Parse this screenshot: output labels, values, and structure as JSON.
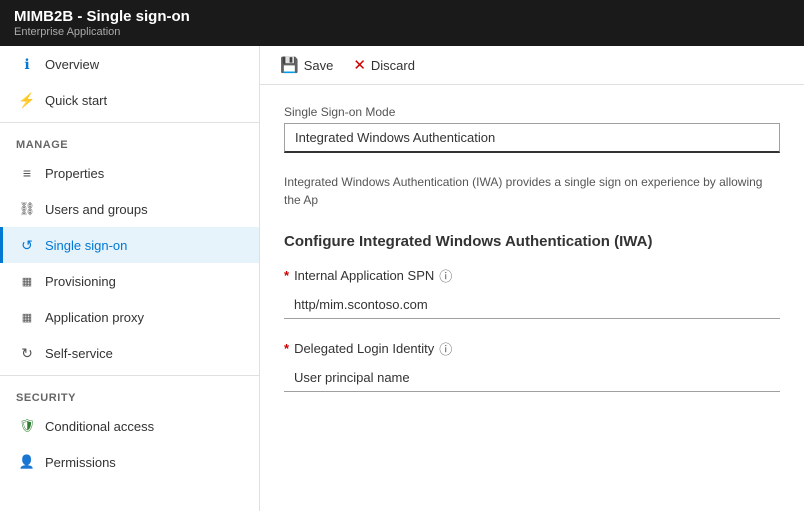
{
  "topbar": {
    "title": "MIMB2B - Single sign-on",
    "subtitle": "Enterprise Application"
  },
  "toolbar": {
    "save_label": "Save",
    "discard_label": "Discard"
  },
  "sidebar": {
    "items_top": [
      {
        "id": "overview",
        "label": "Overview",
        "icon": "ℹ",
        "icon_class": "icon-overview",
        "active": false
      },
      {
        "id": "quickstart",
        "label": "Quick start",
        "icon": "⚡",
        "icon_class": "icon-quickstart",
        "active": false
      }
    ],
    "manage_header": "MANAGE",
    "items_manage": [
      {
        "id": "properties",
        "label": "Properties",
        "icon": "≡",
        "icon_class": "icon-properties",
        "active": false
      },
      {
        "id": "users-groups",
        "label": "Users and groups",
        "icon": "👥",
        "icon_class": "icon-users",
        "active": false
      },
      {
        "id": "single-sign-on",
        "label": "Single sign-on",
        "icon": "↺",
        "icon_class": "icon-sso",
        "active": true
      },
      {
        "id": "provisioning",
        "label": "Provisioning",
        "icon": "⬛",
        "icon_class": "icon-provisioning",
        "active": false
      },
      {
        "id": "application-proxy",
        "label": "Application proxy",
        "icon": "⬛",
        "icon_class": "icon-appproxy",
        "active": false
      },
      {
        "id": "self-service",
        "label": "Self-service",
        "icon": "↻",
        "icon_class": "icon-selfservice",
        "active": false
      }
    ],
    "security_header": "SECURITY",
    "items_security": [
      {
        "id": "conditional-access",
        "label": "Conditional access",
        "icon": "🛡",
        "icon_class": "icon-conditional",
        "active": false
      },
      {
        "id": "permissions",
        "label": "Permissions",
        "icon": "👤",
        "icon_class": "icon-permissions",
        "active": false
      }
    ]
  },
  "form": {
    "sso_mode_label": "Single Sign-on Mode",
    "sso_mode_value": "Integrated Windows Authentication",
    "description": "Integrated Windows Authentication (IWA) provides a single sign on experience by allowing the Ap",
    "iwa_section_title": "Configure Integrated Windows Authentication (IWA)",
    "spn_label": "Internal Application SPN",
    "spn_placeholder": "http/mim.scontoso.com",
    "spn_value": "http/mim.scontoso.com",
    "login_identity_label": "Delegated Login Identity",
    "login_identity_value": "User principal name",
    "login_identity_placeholder": "User principal name"
  }
}
